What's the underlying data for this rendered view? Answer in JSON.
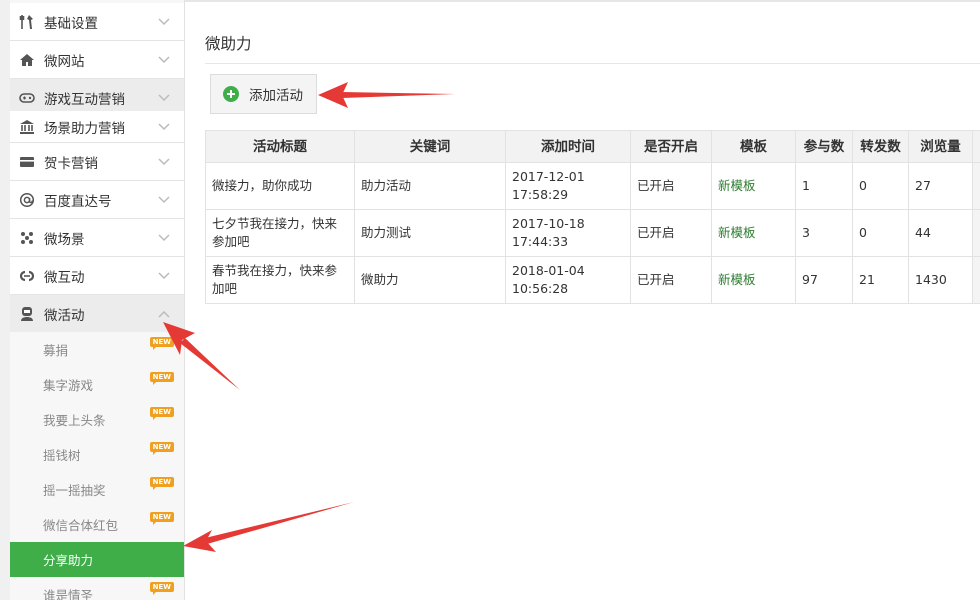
{
  "sidebar": {
    "items": [
      {
        "label": "基础设置",
        "icon": "tools-icon",
        "chevron": "down"
      },
      {
        "label": "微网站",
        "icon": "home-icon",
        "chevron": "down"
      },
      {
        "label": "游戏互动营销",
        "icon": "gamepad-icon",
        "chevron": "down"
      },
      {
        "label": "场景助力营销",
        "icon": "bank-icon",
        "chevron": "down"
      },
      {
        "label": "贺卡营销",
        "icon": "card-icon",
        "chevron": "down"
      },
      {
        "label": "百度直达号",
        "icon": "at-icon",
        "chevron": "down"
      },
      {
        "label": "微场景",
        "icon": "scatter-icon",
        "chevron": "down"
      },
      {
        "label": "微互动",
        "icon": "link-icon",
        "chevron": "down"
      },
      {
        "label": "微活动",
        "icon": "user-icon",
        "chevron": "up"
      }
    ],
    "sub_items": [
      {
        "label": "募捐",
        "badge": "NEW"
      },
      {
        "label": "集字游戏",
        "badge": "NEW"
      },
      {
        "label": "我要上头条",
        "badge": "NEW"
      },
      {
        "label": "摇钱树",
        "badge": "NEW"
      },
      {
        "label": "摇一摇抽奖",
        "badge": "NEW"
      },
      {
        "label": "微信合体红包",
        "badge": "NEW"
      },
      {
        "label": "分享助力",
        "badge": ""
      },
      {
        "label": "谁是情圣",
        "badge": "NEW"
      }
    ]
  },
  "main": {
    "title": "微助力",
    "add_button": "添加活动",
    "table": {
      "headers": [
        "活动标题",
        "关键词",
        "添加时间",
        "是否开启",
        "模板",
        "参与数",
        "转发数",
        "浏览量"
      ],
      "rows": [
        {
          "title": "微接力，助你成功",
          "keyword": "助力活动",
          "time": "2017-12-01 17:58:29",
          "status": "已开启",
          "template": "新模板",
          "join": "1",
          "share": "0",
          "views": "27"
        },
        {
          "title": "七夕节我在接力，快来参加吧",
          "keyword": "助力测试",
          "time": "2017-10-18 17:44:33",
          "status": "已开启",
          "template": "新模板",
          "join": "3",
          "share": "0",
          "views": "44"
        },
        {
          "title": "春节我在接力，快来参加吧",
          "keyword": "微助力",
          "time": "2018-01-04 10:56:28",
          "status": "已开启",
          "template": "新模板",
          "join": "97",
          "share": "21",
          "views": "1430"
        }
      ]
    }
  },
  "colors": {
    "accent_green": "#3fae49",
    "template_link": "#2f7d32",
    "badge_orange": "#f0a020",
    "arrow_red": "#e53935"
  }
}
